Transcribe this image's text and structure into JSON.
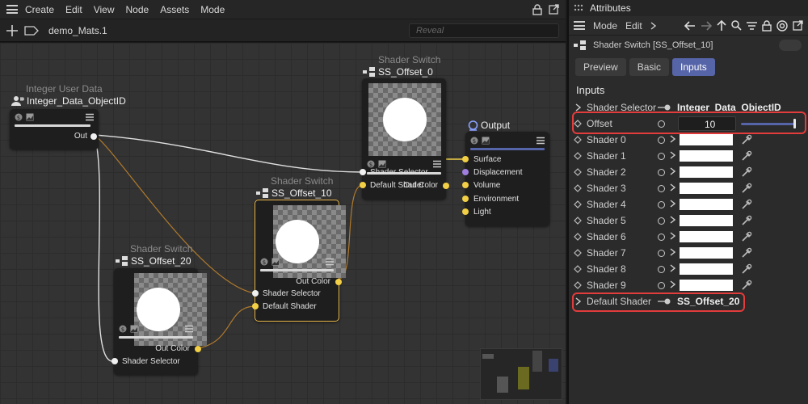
{
  "menu": {
    "items": [
      "Create",
      "Edit",
      "View",
      "Node",
      "Assets",
      "Mode"
    ]
  },
  "toolbar": {
    "doc_name": "demo_Mats.1",
    "reveal_placeholder": "Reveal"
  },
  "nodes": {
    "integer": {
      "category": "Integer User Data",
      "title": "Integer_Data_ObjectID",
      "out": "Out"
    },
    "ss0": {
      "category": "Shader Switch",
      "title": "SS_Offset_0",
      "out": "Out Color",
      "in1": "Shader Selector",
      "in2": "Default Shader"
    },
    "ss10": {
      "category": "Shader Switch",
      "title": "SS_Offset_10",
      "out": "Out Color",
      "in1": "Shader Selector",
      "in2": "Default Shader"
    },
    "ss20": {
      "category": "Shader Switch",
      "title": "SS_Offset_20",
      "out": "Out Color",
      "in1": "Shader Selector"
    },
    "output": {
      "title": "Output",
      "ports": [
        "Surface",
        "Displacement",
        "Volume",
        "Environment",
        "Light"
      ]
    }
  },
  "attributes": {
    "panel_title": "Attributes",
    "mode_label": "Mode",
    "edit_label": "Edit",
    "object_label": "Shader Switch [SS_Offset_10]",
    "tabs": [
      "Preview",
      "Basic",
      "Inputs"
    ],
    "active_tab": "Inputs",
    "section": "Inputs",
    "shader_selector": {
      "label": "Shader Selector",
      "value": "Integer_Data_ObjectID"
    },
    "offset": {
      "label": "Offset",
      "value": "10"
    },
    "shaders": [
      "Shader 0",
      "Shader 1",
      "Shader 2",
      "Shader 3",
      "Shader 4",
      "Shader 5",
      "Shader 6",
      "Shader 7",
      "Shader 8",
      "Shader 9"
    ],
    "default_shader": {
      "label": "Default Shader",
      "value": "SS_Offset_20"
    }
  },
  "colors": {
    "accent": "#5664a8",
    "wire_white": "#e0e0e0",
    "wire_orange": "#b07a2c",
    "highlight": "#e23c3c",
    "port_yellow": "#f2cf45"
  }
}
